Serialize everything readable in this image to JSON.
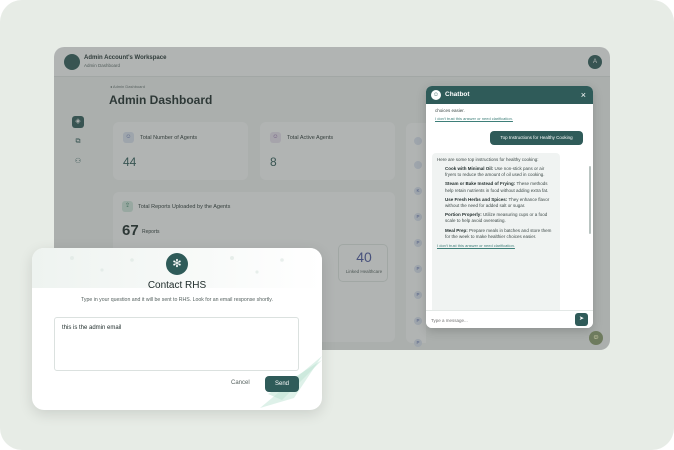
{
  "workspace": {
    "title": "Admin Account's Workspace",
    "subtitle": "Admin Dashboard",
    "user_initial": "A"
  },
  "page": {
    "breadcrumb": "Admin Dashboard",
    "title": "Admin Dashboard"
  },
  "stats": [
    {
      "label": "Total Number of Agents",
      "value": "44"
    },
    {
      "label": "Total Active Agents",
      "value": "8"
    }
  ],
  "reports": {
    "label": "Total Reports Uploaded by the Agents",
    "value": "67",
    "unit": "Reports",
    "sub_value": "40",
    "sub_label": "Linked Healthcare"
  },
  "right_column_letters": [
    "K",
    "P",
    "P",
    "P",
    "P",
    "P",
    "P"
  ],
  "chatbot": {
    "title": "Chatbot",
    "close": "×",
    "prev_tail": "choices easier.",
    "trust_link": "I don't trust this answer or need clarification.",
    "user_message": "Top Instructions for Healthy Cooking",
    "bot_intro": "Here are some top instructions for healthy cooking:",
    "tips": [
      {
        "title": "Cook with Minimal Oil:",
        "text": "Use non-stick pans or air fryers to reduce the amount of oil used in cooking."
      },
      {
        "title": "Steam or Bake Instead of Frying:",
        "text": "These methods help retain nutrients in food without adding extra fat."
      },
      {
        "title": "Use Fresh Herbs and Spices:",
        "text": "They enhance flavor without the need for added salt or sugar."
      },
      {
        "title": "Portion Properly:",
        "text": "Utilize measuring cups or a food scale to help avoid overeating."
      },
      {
        "title": "Meal Prep:",
        "text": "Prepare meals in batches and store them for the week to make healthier choices easier."
      }
    ],
    "trust_link_2": "I don't trust this answer or need clarification.",
    "input_placeholder": "Type a message...",
    "timestamp": "Mar 14, 2025, 12:00 AM"
  },
  "modal": {
    "title": "Contact RHS",
    "description": "Type in your question and it will be sent to RHS. Look for an email response shortly.",
    "message": "this is the admin email",
    "cancel": "Cancel",
    "send": "Send"
  },
  "colors": {
    "primary": "#2f5b59",
    "accent_blue": "#4b57a0",
    "background": "#e7ece6"
  }
}
